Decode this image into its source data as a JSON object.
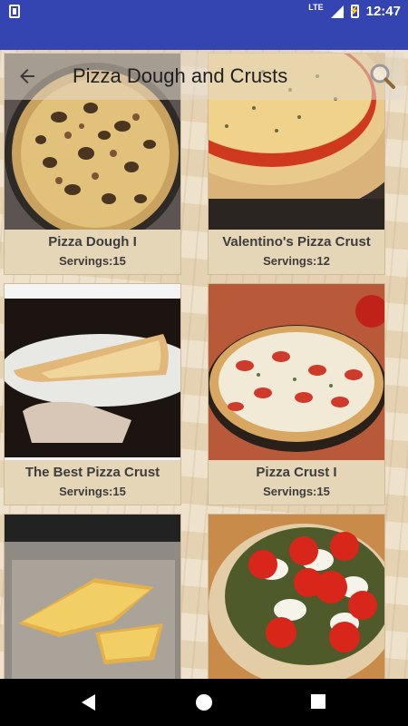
{
  "status_bar": {
    "network": "LTE",
    "time": "12:47"
  },
  "toolbar": {
    "title": "Pizza Dough and Crusts"
  },
  "recipes": [
    {
      "title": "Pizza Dough I",
      "servings": "Servings:15"
    },
    {
      "title": "Valentino's Pizza Crust",
      "servings": "Servings:12"
    },
    {
      "title": "The Best Pizza Crust",
      "servings": "Servings:15"
    },
    {
      "title": "Pizza Crust I",
      "servings": "Servings:15"
    }
  ],
  "colors": {
    "app_bar": "#3444b1",
    "card_text": "#3d3d3d",
    "nav_bar": "#000000"
  },
  "icons": [
    "sd-card-icon",
    "signal-icon",
    "battery-icon",
    "back-arrow-icon",
    "search-icon",
    "nav-back-icon",
    "nav-home-icon",
    "nav-recents-icon"
  ]
}
